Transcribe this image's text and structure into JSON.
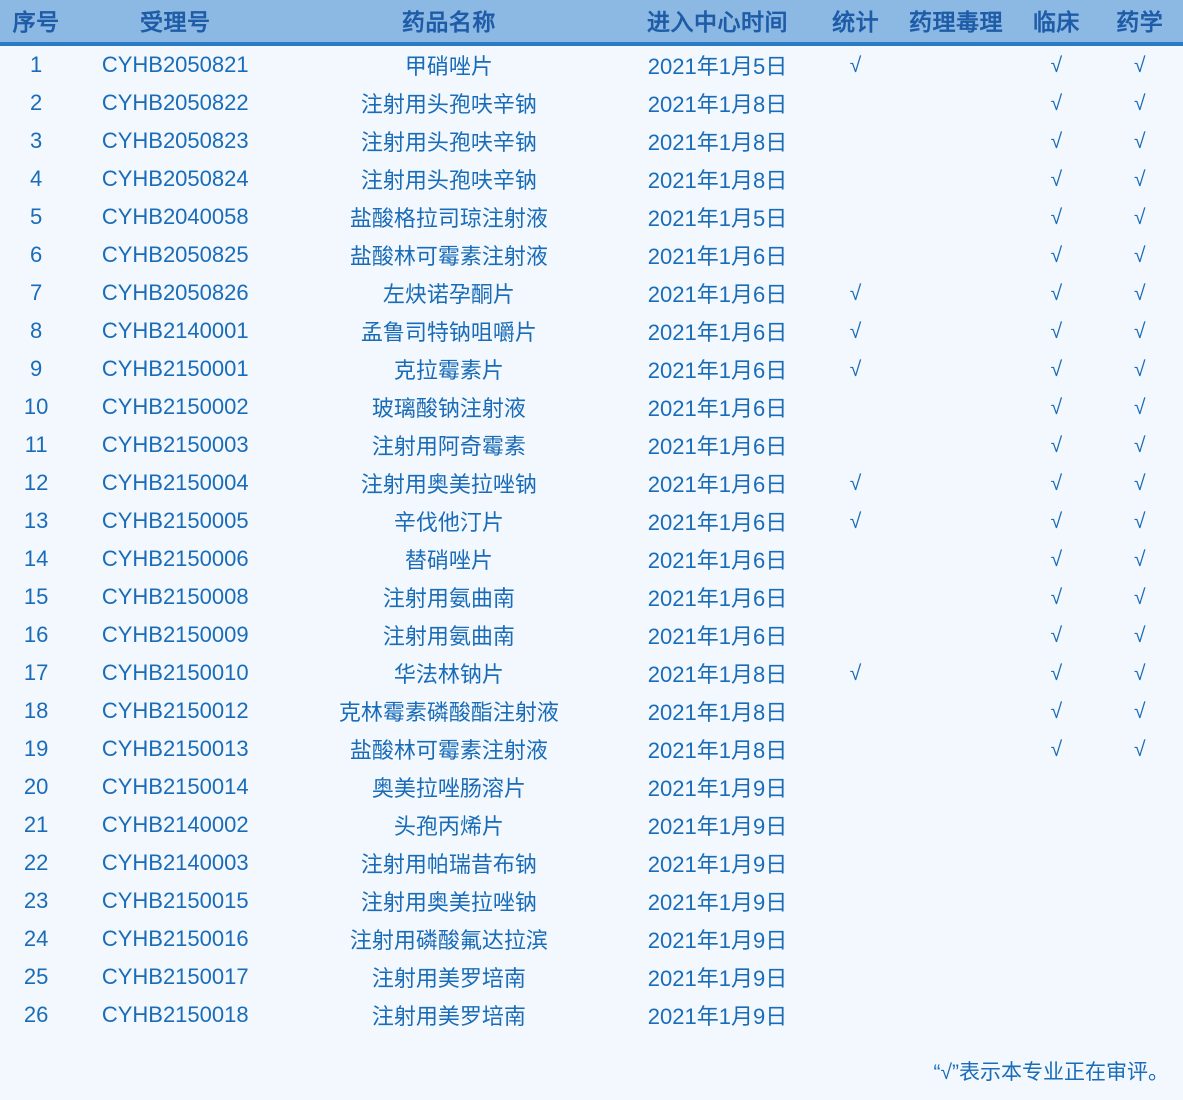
{
  "table": {
    "columns": [
      {
        "key": "index",
        "label": "序号"
      },
      {
        "key": "acceptance",
        "label": "受理号"
      },
      {
        "key": "drug",
        "label": "药品名称"
      },
      {
        "key": "date",
        "label": "进入中心时间"
      },
      {
        "key": "statistics",
        "label": "统计"
      },
      {
        "key": "pharmtox",
        "label": "药理毒理"
      },
      {
        "key": "clinical",
        "label": "临床"
      },
      {
        "key": "pharmacy",
        "label": "药学"
      }
    ],
    "check_glyph": "√",
    "rows": [
      {
        "index": "1",
        "acceptance": "CYHB2050821",
        "drug": "甲硝唑片",
        "date": "2021年1月5日",
        "statistics": "√",
        "pharmtox": "",
        "clinical": "√",
        "pharmacy": "√"
      },
      {
        "index": "2",
        "acceptance": "CYHB2050822",
        "drug": "注射用头孢呋辛钠",
        "date": "2021年1月8日",
        "statistics": "",
        "pharmtox": "",
        "clinical": "√",
        "pharmacy": "√"
      },
      {
        "index": "3",
        "acceptance": "CYHB2050823",
        "drug": "注射用头孢呋辛钠",
        "date": "2021年1月8日",
        "statistics": "",
        "pharmtox": "",
        "clinical": "√",
        "pharmacy": "√"
      },
      {
        "index": "4",
        "acceptance": "CYHB2050824",
        "drug": "注射用头孢呋辛钠",
        "date": "2021年1月8日",
        "statistics": "",
        "pharmtox": "",
        "clinical": "√",
        "pharmacy": "√"
      },
      {
        "index": "5",
        "acceptance": "CYHB2040058",
        "drug": "盐酸格拉司琼注射液",
        "date": "2021年1月5日",
        "statistics": "",
        "pharmtox": "",
        "clinical": "√",
        "pharmacy": "√"
      },
      {
        "index": "6",
        "acceptance": "CYHB2050825",
        "drug": "盐酸林可霉素注射液",
        "date": "2021年1月6日",
        "statistics": "",
        "pharmtox": "",
        "clinical": "√",
        "pharmacy": "√"
      },
      {
        "index": "7",
        "acceptance": "CYHB2050826",
        "drug": "左炔诺孕酮片",
        "date": "2021年1月6日",
        "statistics": "√",
        "pharmtox": "",
        "clinical": "√",
        "pharmacy": "√"
      },
      {
        "index": "8",
        "acceptance": "CYHB2140001",
        "drug": "孟鲁司特钠咀嚼片",
        "date": "2021年1月6日",
        "statistics": "√",
        "pharmtox": "",
        "clinical": "√",
        "pharmacy": "√"
      },
      {
        "index": "9",
        "acceptance": "CYHB2150001",
        "drug": "克拉霉素片",
        "date": "2021年1月6日",
        "statistics": "√",
        "pharmtox": "",
        "clinical": "√",
        "pharmacy": "√"
      },
      {
        "index": "10",
        "acceptance": "CYHB2150002",
        "drug": "玻璃酸钠注射液",
        "date": "2021年1月6日",
        "statistics": "",
        "pharmtox": "",
        "clinical": "√",
        "pharmacy": "√"
      },
      {
        "index": "11",
        "acceptance": "CYHB2150003",
        "drug": "注射用阿奇霉素",
        "date": "2021年1月6日",
        "statistics": "",
        "pharmtox": "",
        "clinical": "√",
        "pharmacy": "√"
      },
      {
        "index": "12",
        "acceptance": "CYHB2150004",
        "drug": "注射用奥美拉唑钠",
        "date": "2021年1月6日",
        "statistics": "√",
        "pharmtox": "",
        "clinical": "√",
        "pharmacy": "√"
      },
      {
        "index": "13",
        "acceptance": "CYHB2150005",
        "drug": "辛伐他汀片",
        "date": "2021年1月6日",
        "statistics": "√",
        "pharmtox": "",
        "clinical": "√",
        "pharmacy": "√"
      },
      {
        "index": "14",
        "acceptance": "CYHB2150006",
        "drug": "替硝唑片",
        "date": "2021年1月6日",
        "statistics": "",
        "pharmtox": "",
        "clinical": "√",
        "pharmacy": "√"
      },
      {
        "index": "15",
        "acceptance": "CYHB2150008",
        "drug": "注射用氨曲南",
        "date": "2021年1月6日",
        "statistics": "",
        "pharmtox": "",
        "clinical": "√",
        "pharmacy": "√"
      },
      {
        "index": "16",
        "acceptance": "CYHB2150009",
        "drug": "注射用氨曲南",
        "date": "2021年1月6日",
        "statistics": "",
        "pharmtox": "",
        "clinical": "√",
        "pharmacy": "√"
      },
      {
        "index": "17",
        "acceptance": "CYHB2150010",
        "drug": "华法林钠片",
        "date": "2021年1月8日",
        "statistics": "√",
        "pharmtox": "",
        "clinical": "√",
        "pharmacy": "√"
      },
      {
        "index": "18",
        "acceptance": "CYHB2150012",
        "drug": "克林霉素磷酸酯注射液",
        "date": "2021年1月8日",
        "statistics": "",
        "pharmtox": "",
        "clinical": "√",
        "pharmacy": "√"
      },
      {
        "index": "19",
        "acceptance": "CYHB2150013",
        "drug": "盐酸林可霉素注射液",
        "date": "2021年1月8日",
        "statistics": "",
        "pharmtox": "",
        "clinical": "√",
        "pharmacy": "√"
      },
      {
        "index": "20",
        "acceptance": "CYHB2150014",
        "drug": "奥美拉唑肠溶片",
        "date": "2021年1月9日",
        "statistics": "",
        "pharmtox": "",
        "clinical": "",
        "pharmacy": ""
      },
      {
        "index": "21",
        "acceptance": "CYHB2140002",
        "drug": "头孢丙烯片",
        "date": "2021年1月9日",
        "statistics": "",
        "pharmtox": "",
        "clinical": "",
        "pharmacy": ""
      },
      {
        "index": "22",
        "acceptance": "CYHB2140003",
        "drug": "注射用帕瑞昔布钠",
        "date": "2021年1月9日",
        "statistics": "",
        "pharmtox": "",
        "clinical": "",
        "pharmacy": ""
      },
      {
        "index": "23",
        "acceptance": "CYHB2150015",
        "drug": "注射用奥美拉唑钠",
        "date": "2021年1月9日",
        "statistics": "",
        "pharmtox": "",
        "clinical": "",
        "pharmacy": ""
      },
      {
        "index": "24",
        "acceptance": "CYHB2150016",
        "drug": "注射用磷酸氟达拉滨",
        "date": "2021年1月9日",
        "statistics": "",
        "pharmtox": "",
        "clinical": "",
        "pharmacy": ""
      },
      {
        "index": "25",
        "acceptance": "CYHB2150017",
        "drug": "注射用美罗培南",
        "date": "2021年1月9日",
        "statistics": "",
        "pharmtox": "",
        "clinical": "",
        "pharmacy": ""
      },
      {
        "index": "26",
        "acceptance": "CYHB2150018",
        "drug": "注射用美罗培南",
        "date": "2021年1月9日",
        "statistics": "",
        "pharmtox": "",
        "clinical": "",
        "pharmacy": ""
      }
    ]
  },
  "footnote": "“√”表示本专业正在审评。",
  "colors": {
    "header_bg": "#8cb9e3",
    "header_text": "#1f5ca8",
    "header_rule": "#2a7ac4",
    "body_bg": "#f2f8fd",
    "body_text": "#1a6cb8"
  }
}
